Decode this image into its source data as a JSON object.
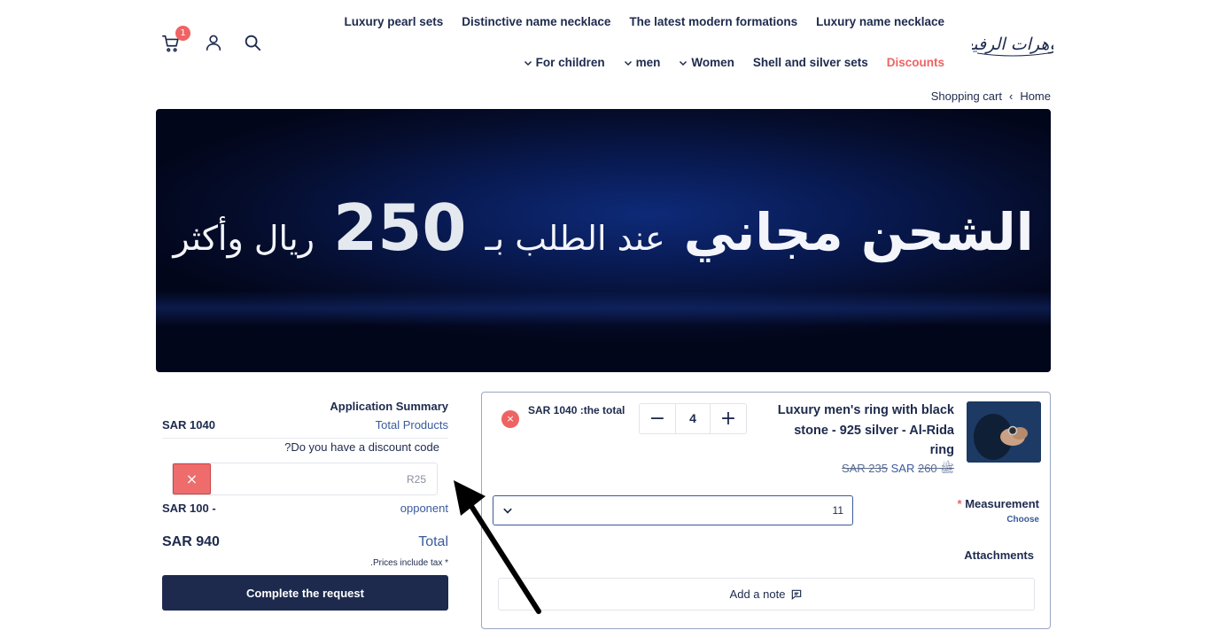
{
  "header": {
    "cart_count": "1",
    "nav_row1": [
      "Luxury pearl sets",
      "Distinctive name necklace",
      "The latest modern formations",
      "Luxury name necklace"
    ],
    "nav_row2": [
      {
        "label": "For children",
        "dropdown": true
      },
      {
        "label": "men",
        "dropdown": true
      },
      {
        "label": "Women",
        "dropdown": true
      },
      {
        "label": "Shell and silver sets",
        "dropdown": false
      },
      {
        "label": "Discounts",
        "dropdown": false
      }
    ],
    "logo_text": "مجوهرات الرفيعان"
  },
  "breadcrumb": {
    "current": "Shopping cart",
    "separator": "‹",
    "home": "Home"
  },
  "banner": {
    "headline": "الشحن مجاني",
    "mid": "عند الطلب بـ",
    "amount": "250",
    "tail": "ريال وأكثر"
  },
  "summary": {
    "title": "Application Summary",
    "total_products_label": "Total Products",
    "total_products_value": "SAR 1040",
    "discount_question": "?Do you have a discount code",
    "discount_code": "R25",
    "discount_clear": "×",
    "opponent_label": "opponent",
    "opponent_value": "SAR 100 -",
    "total_label": "Total",
    "total_value": "SAR 940",
    "tax_note": ".Prices include tax *",
    "complete_button": "Complete the request"
  },
  "cart_item": {
    "remove": "×",
    "line_total": "SAR 1040 :the total",
    "quantity": "4",
    "qty_minus": "−",
    "qty_plus": "+",
    "name": "Luxury men's ring with black stone - 925 silver - Al-Rida ring",
    "price_old": "SAR 235",
    "price_new": "SAR",
    "price_extra": "ﷺ 260",
    "measurement_label": "Measurement",
    "measurement_required": "*",
    "measurement_choose": "Choose",
    "measurement_value": "11",
    "attachments_label": "Attachments",
    "add_note": "Add a note"
  },
  "colors": {
    "primary": "#1d2a4d",
    "accent_red": "#ef6363",
    "link_blue": "#3a5a9c"
  }
}
